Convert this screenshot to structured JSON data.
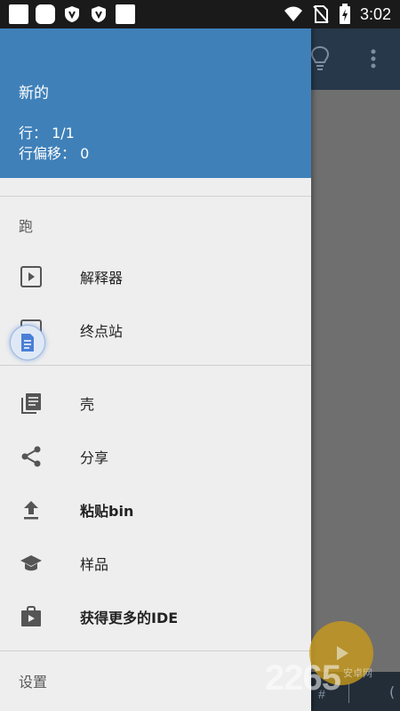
{
  "status_bar": {
    "time": "3:02"
  },
  "drawer": {
    "header": {
      "title": "新的",
      "line_label": "行： 1/1",
      "offset_label": "行偏移： 0"
    },
    "sections": {
      "run": "跑",
      "settings": "设置"
    },
    "items": [
      {
        "label": "解释器",
        "icon": "play-box-icon"
      },
      {
        "label": "终点站",
        "icon": "play-box-icon"
      },
      {
        "label": "壳",
        "icon": "library-books-icon"
      },
      {
        "label": "分享",
        "icon": "share-icon"
      },
      {
        "label": "粘贴bin",
        "icon": "upload-icon"
      },
      {
        "label": "样品",
        "icon": "school-icon"
      },
      {
        "label": "获得更多的IDE",
        "icon": "shop-icon"
      }
    ]
  },
  "background_app": {
    "bottom_symbol": "#",
    "bottom_paren": "("
  },
  "watermark": {
    "text": "2265",
    "sub": "安卓网"
  },
  "colors": {
    "header": "#3f80b9",
    "drawer_bg": "#eeeeee",
    "toolbar": "#27384a",
    "fab": "#c89a1c"
  }
}
